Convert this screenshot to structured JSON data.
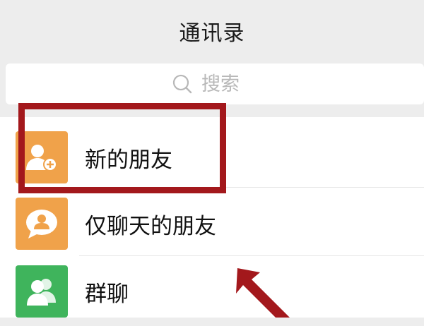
{
  "header": {
    "title": "通讯录"
  },
  "search": {
    "placeholder": "搜索",
    "icon": "search-icon"
  },
  "contacts_menu": {
    "items": [
      {
        "label": "新的朋友",
        "icon": "add-friend-icon",
        "color": "#f0a24a"
      },
      {
        "label": "仅聊天的朋友",
        "icon": "chat-only-friend-icon",
        "color": "#f0a24a"
      },
      {
        "label": "群聊",
        "icon": "group-chat-icon",
        "color": "#3fb45c"
      }
    ]
  },
  "annotation": {
    "highlight_color": "#a3181c"
  }
}
